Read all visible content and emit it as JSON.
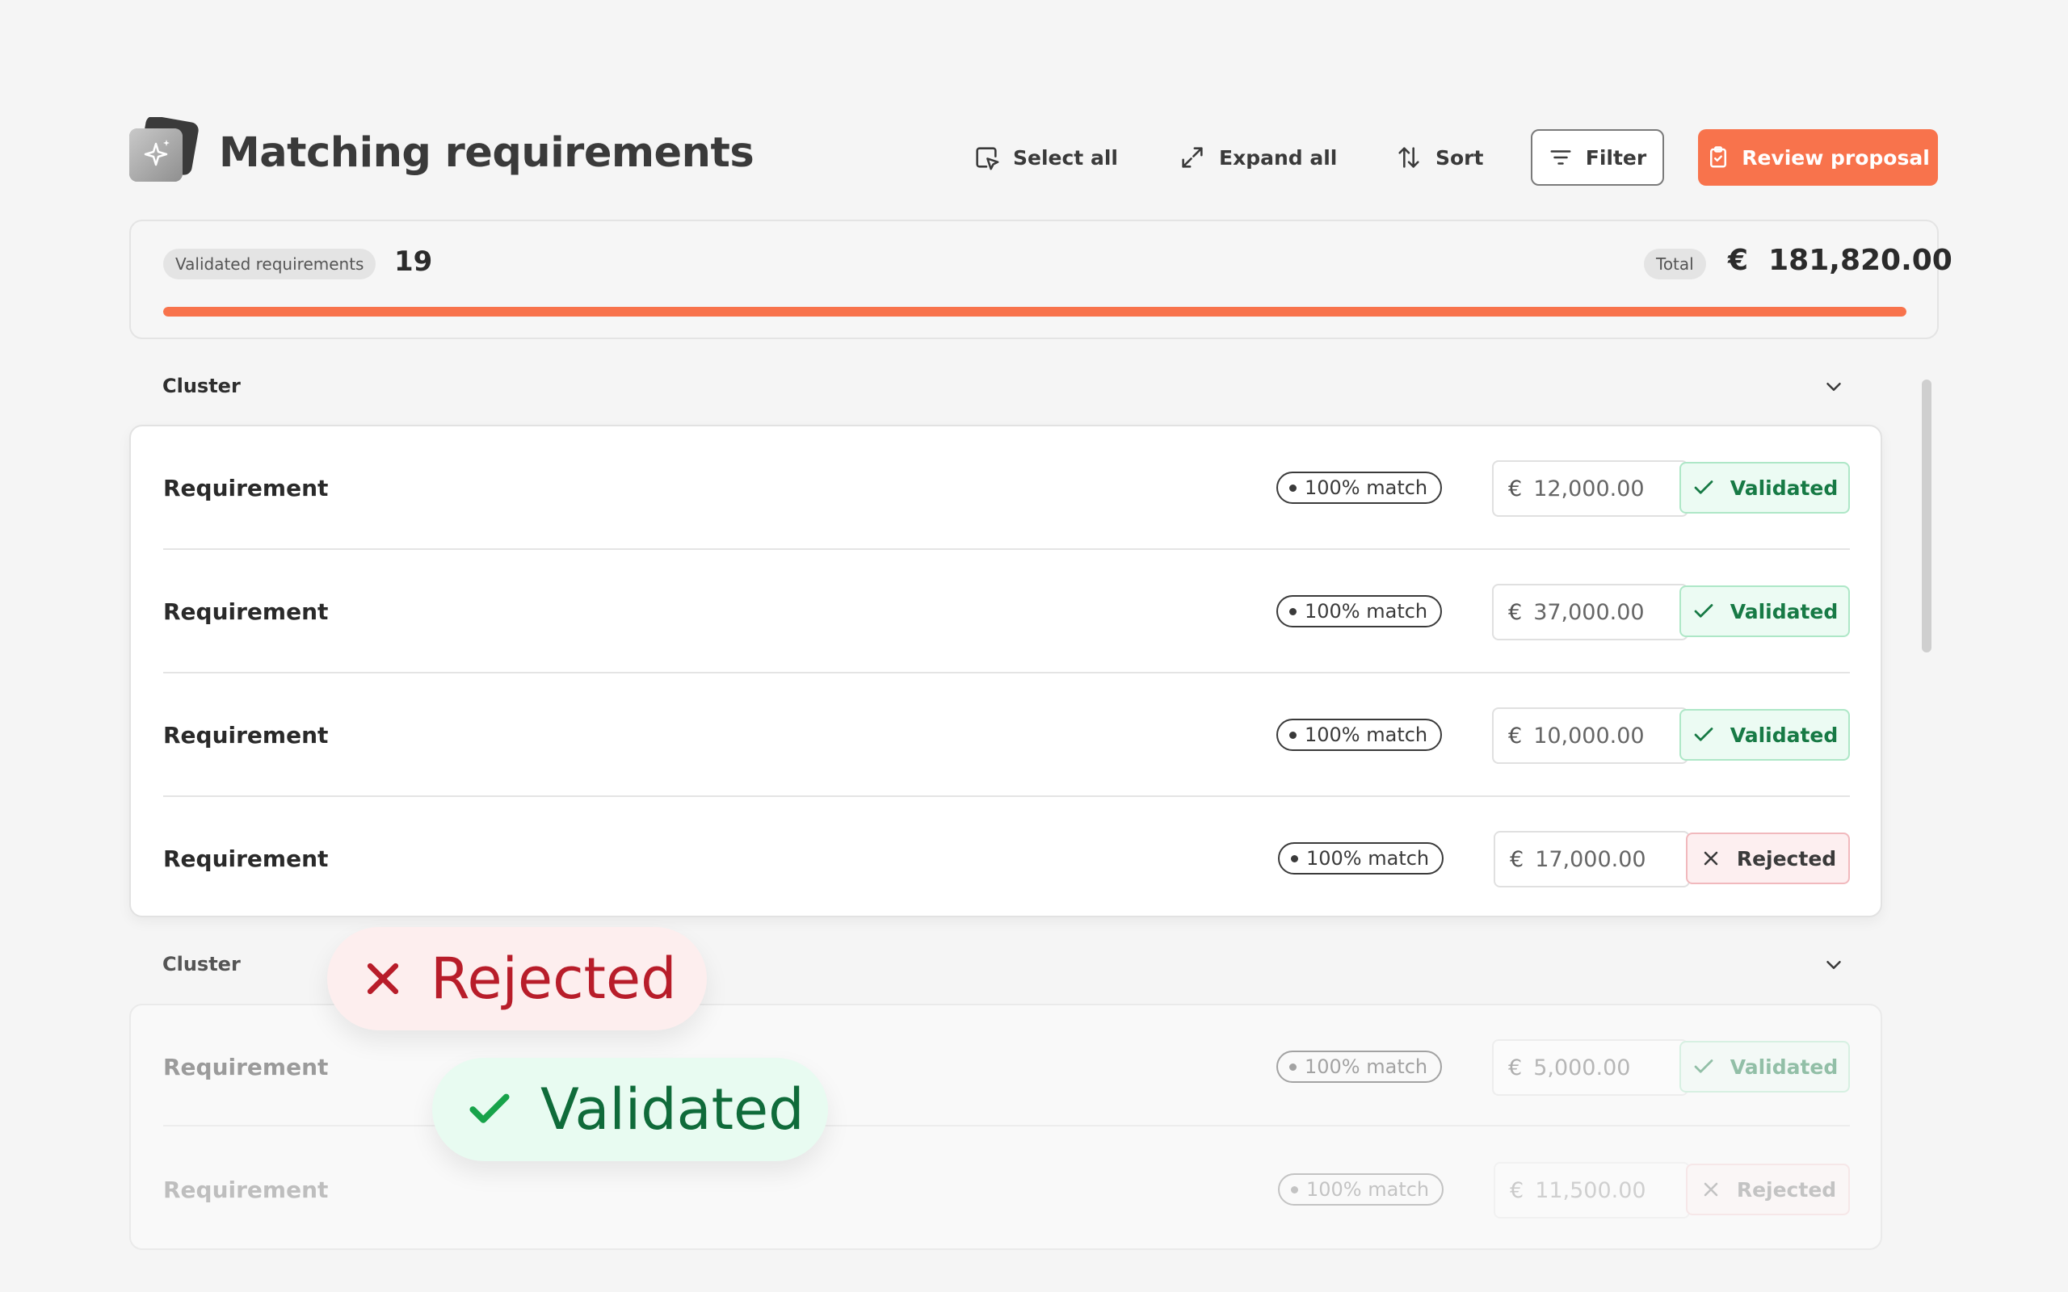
{
  "header": {
    "title": "Matching requirements",
    "logo_icon": "sparkle-icon",
    "actions": {
      "select_all": "Select all",
      "expand_all": "Expand all",
      "sort": "Sort",
      "filter": "Filter",
      "review": "Review proposal"
    }
  },
  "summary": {
    "validated_label": "Validated requirements",
    "validated_count": "19",
    "total_label": "Total",
    "total_value": "€  181,820.00",
    "progress_fraction": 1.0
  },
  "clusters": [
    {
      "label": "Cluster",
      "rows": [
        {
          "name": "Requirement",
          "match": "100% match",
          "currency": "€",
          "amount": "12,000.00",
          "status": "Validated"
        },
        {
          "name": "Requirement",
          "match": "100% match",
          "currency": "€",
          "amount": "37,000.00",
          "status": "Validated"
        },
        {
          "name": "Requirement",
          "match": "100% match",
          "currency": "€",
          "amount": "10,000.00",
          "status": "Validated"
        },
        {
          "name": "Requirement",
          "match": "100% match",
          "currency": "€",
          "amount": "17,000.00",
          "status": "Rejected"
        }
      ]
    },
    {
      "label": "Cluster",
      "rows": [
        {
          "name": "Requirement",
          "match": "100% match",
          "currency": "€",
          "amount": "5,000.00",
          "status": "Validated"
        },
        {
          "name": "Requirement",
          "match": "100% match",
          "currency": "€",
          "amount": "11,500.00",
          "status": "Rejected"
        }
      ]
    }
  ],
  "callouts": {
    "rejected": "Rejected",
    "validated": "Validated"
  },
  "colors": {
    "accent": "#f8734c",
    "validated_text": "#177a45",
    "rejected_text": "#b81d2a"
  }
}
